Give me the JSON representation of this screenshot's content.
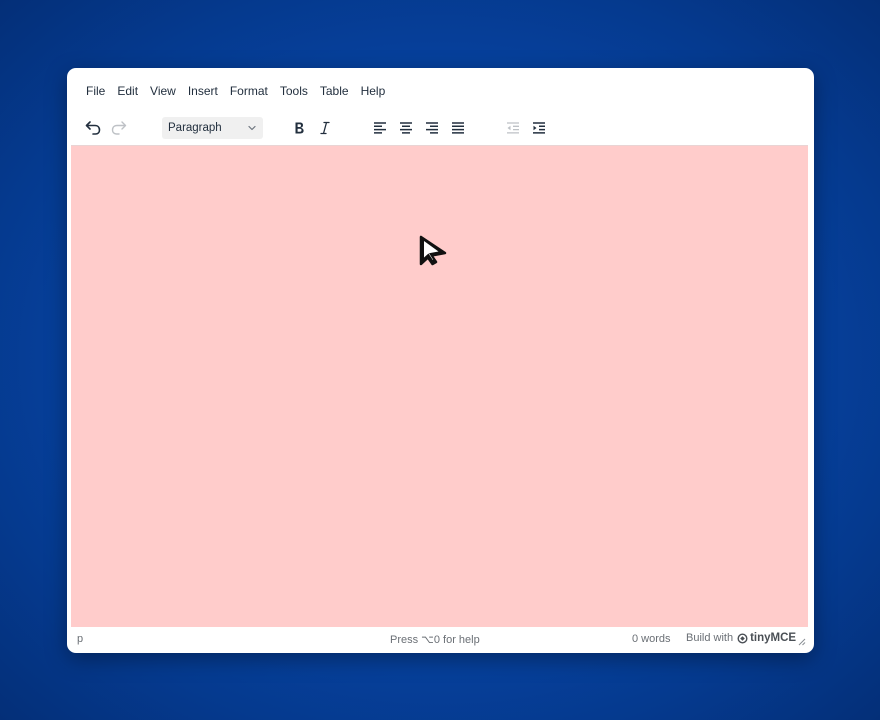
{
  "menubar": {
    "items": [
      "File",
      "Edit",
      "View",
      "Insert",
      "Format",
      "Tools",
      "Table",
      "Help"
    ]
  },
  "toolbar": {
    "block_format": "Paragraph",
    "buttons": [
      "undo",
      "redo",
      "bold",
      "italic",
      "align-left",
      "align-center",
      "align-right",
      "justify",
      "outdent",
      "indent"
    ]
  },
  "content": {
    "background": "#ffcccb"
  },
  "statusbar": {
    "path": "p",
    "help_text": "Press ⌥0 for help",
    "word_count": "0 words",
    "brand_prefix": "Build with",
    "brand_name": "tinyMCE"
  },
  "colors": {
    "desktop": "#0745a6",
    "editor_bg": "#ffffff",
    "content_bg": "#ffcccb",
    "text": "#222f3e"
  }
}
